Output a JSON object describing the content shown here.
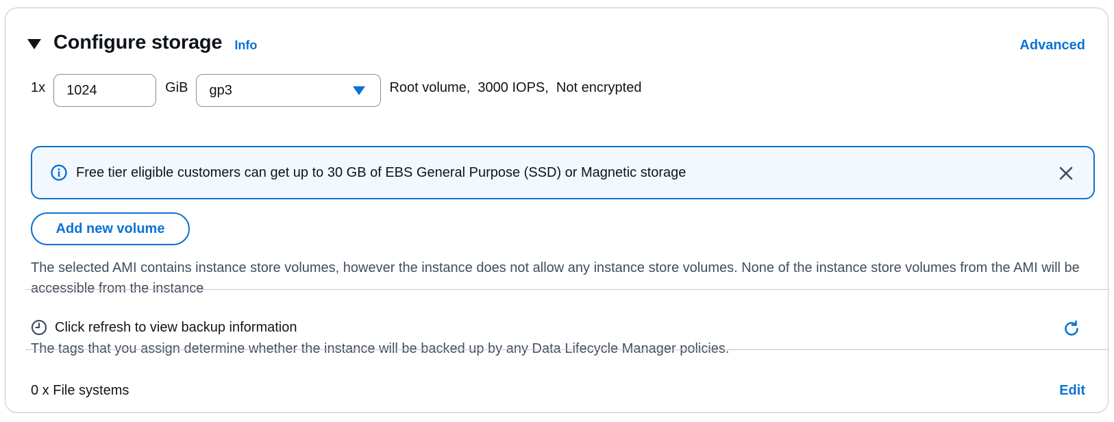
{
  "section": {
    "title": "Configure storage",
    "info_label": "Info",
    "advanced_label": "Advanced"
  },
  "volume": {
    "multiplier": "1x",
    "size_value": "1024",
    "unit": "GiB",
    "type_selected": "gp3",
    "description": "Root volume,  3000 IOPS,  Not encrypted"
  },
  "alert": {
    "type": "info",
    "message": "Free tier eligible customers can get up to 30 GB of EBS General Purpose (SSD) or Magnetic storage"
  },
  "add_volume_label": "Add new volume",
  "instance_store_note": "The selected AMI contains instance store volumes, however the instance does not allow any instance store volumes. None of the instance store volumes from the AMI will be accessible from the instance",
  "backup": {
    "title": "Click refresh to view backup information",
    "subtitle": "The tags that you assign determine whether the instance will be backed up by any Data Lifecycle Manager policies."
  },
  "file_systems": {
    "summary": "0 x File systems",
    "edit_label": "Edit"
  },
  "icons": {
    "caret": "caret-down-icon",
    "select": "dropdown-arrow-icon",
    "alert_info": "info-icon",
    "close": "close-icon",
    "clock": "clock-icon",
    "refresh": "refresh-icon"
  },
  "colors": {
    "accent": "#0972d3",
    "alert_bg": "#f2f8fd",
    "border": "#c6c6cd",
    "text": "#0f141a",
    "muted_text": "#414d5c"
  }
}
